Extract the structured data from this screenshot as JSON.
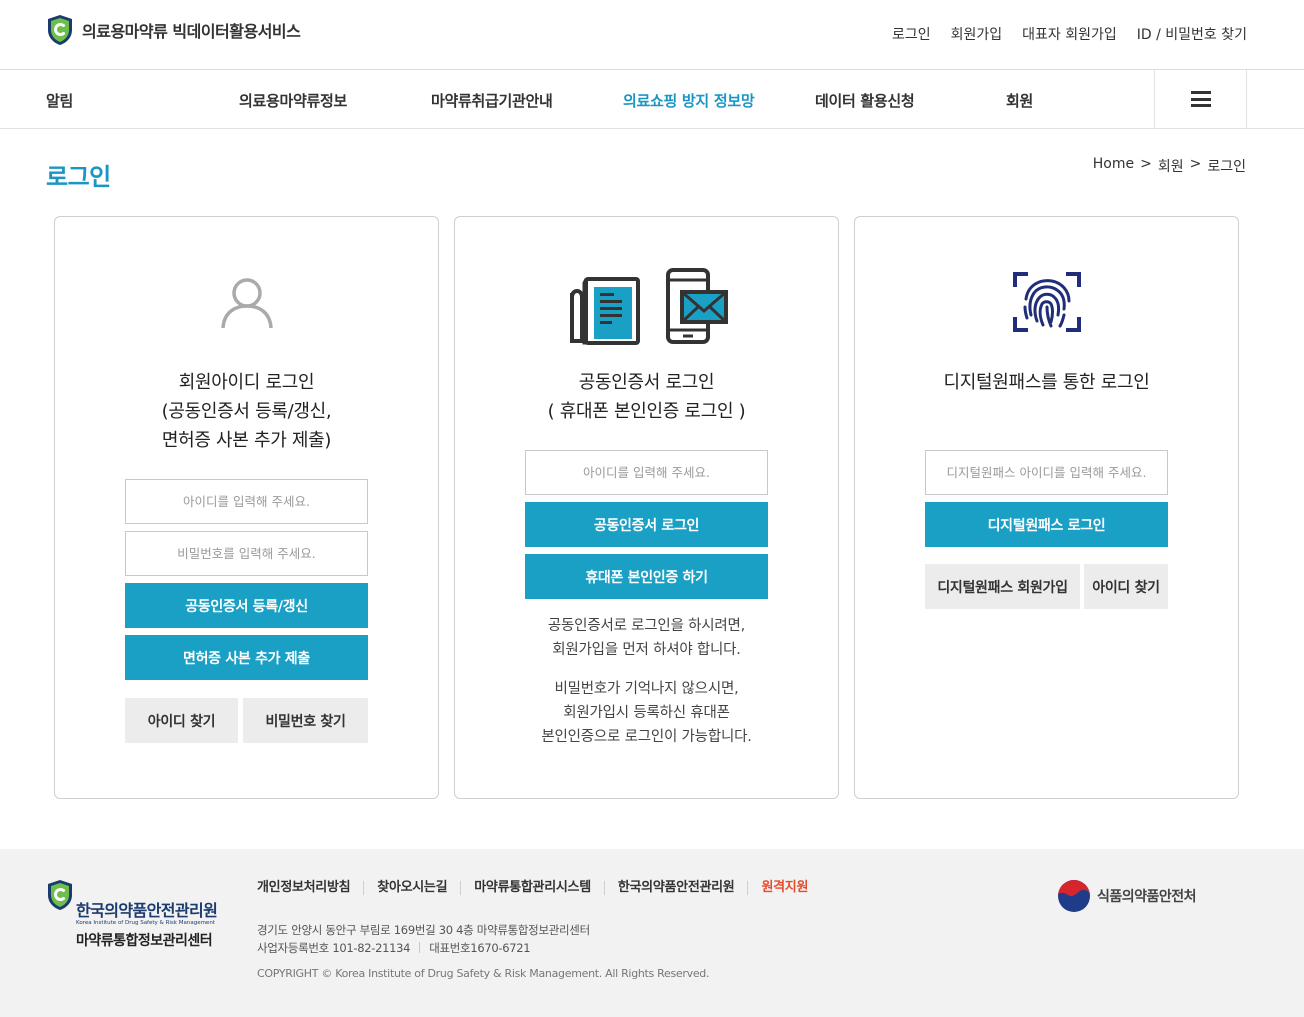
{
  "header": {
    "site_title": "의료용마약류 빅데이터활용서비스",
    "util_links": [
      "로그인",
      "회원가입",
      "대표자 회원가입",
      "ID / 비밀번호 찾기"
    ]
  },
  "gnb": {
    "items": [
      "알림",
      "의료용마약류정보",
      "마약류취급기관안내",
      "의료쇼핑 방지 정보망",
      "데이터 활용신청",
      "회원"
    ],
    "active_index": 3
  },
  "page": {
    "title": "로그인",
    "breadcrumb": [
      "Home",
      ">",
      "회원",
      ">",
      "로그인"
    ]
  },
  "cards": {
    "id_login": {
      "title": "회원아이디 로그인\n(공동인증서 등록/갱신,\n면허증 사본 추가 제출)",
      "id_placeholder": "아이디를 입력해 주세요.",
      "pw_placeholder": "비밀번호를 입력해 주세요.",
      "btn_cert": "공동인증서 등록/갱신",
      "btn_license": "면허증 사본 추가 제출",
      "btn_find_id": "아이디 찾기",
      "btn_find_pw": "비밀번호 찾기"
    },
    "cert_login": {
      "title": "공동인증서 로그인\n( 휴대폰 본인인증 로그인 )",
      "id_placeholder": "아이디를 입력해 주세요.",
      "btn_cert": "공동인증서 로그인",
      "btn_phone": "휴대폰 본인인증 하기",
      "note_1": "공동인증서로 로그인을 하시려면,\n회원가입을 먼저 하셔야 합니다.",
      "note_2": "비밀번호가 기억나지 않으시면,\n회원가입시 등록하신 휴대폰\n본인인증으로 로그인이 가능합니다."
    },
    "digital_login": {
      "title": "디지털원패스를 통한 로그인",
      "id_placeholder": "디지털원패스 아이디를 입력해 주세요.",
      "btn_login": "디지털원패스 로그인",
      "btn_join": "디지털원패스 회원가입",
      "btn_find_id": "아이디 찾기"
    }
  },
  "footer": {
    "org_name": "한국의약품안전관리원",
    "org_name_en": "Korea Institute of Drug Safety & Risk Management",
    "center_name": "마약류통합정보관리센터",
    "links": [
      "개인정보처리방침",
      "찾아오시는길",
      "마약류통합관리시스템",
      "한국의약품안전관리원",
      "원격지원"
    ],
    "address": "경기도 안양시 동안구 부림로 169번길 30 4층 마약류통합정보관리센터",
    "biz_no": "사업자등록번호 101-82-21134",
    "tel": "대표번호1670-6721",
    "copyright": "COPYRIGHT © Korea Institute of Drug Safety & Risk Management. All Rights Reserved.",
    "mfds_name": "식품의약품안전처"
  },
  "colors": {
    "accent": "#1ba0c5",
    "title_blue": "#1a96c4",
    "remote_link": "#e64a2c",
    "navy": "#1b3b6f"
  },
  "icons": [
    "shield-logo-icon",
    "user-icon",
    "certificate-document-icon",
    "phone-mail-icon",
    "fingerprint-icon",
    "menu-icon",
    "mfds-emblem-icon"
  ]
}
